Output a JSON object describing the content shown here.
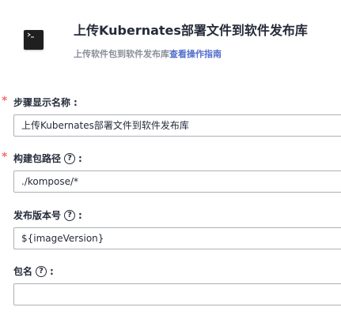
{
  "header": {
    "icon": "terminal-icon",
    "title": "上传Kubernates部署文件到软件发布库",
    "subtitle_text": "上传软件包到软件发布库",
    "subtitle_link": "查看操作指南"
  },
  "form": {
    "fields": [
      {
        "label": "步骤显示名称",
        "required": true,
        "has_help": false,
        "value": "上传Kubernates部署文件到软件发布库"
      },
      {
        "label": "构建包路径",
        "required": true,
        "has_help": true,
        "value": "./kompose/*"
      },
      {
        "label": "发布版本号",
        "required": false,
        "has_help": true,
        "value": "${imageVersion}"
      },
      {
        "label": "包名",
        "required": false,
        "has_help": true,
        "value": ""
      }
    ],
    "required_mark": "*",
    "help_glyph": "?",
    "colon": ":"
  },
  "colors": {
    "required": "#f66f6a",
    "link": "#526ecc",
    "muted": "#8a8e99",
    "text": "#252b3a",
    "border": "#adb0b8"
  }
}
